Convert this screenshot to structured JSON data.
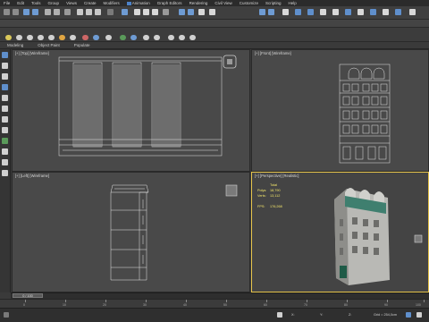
{
  "menu": {
    "items": [
      "File",
      "Edit",
      "Tools",
      "Group",
      "Views",
      "Create",
      "Modifiers",
      "Animation",
      "Graph Editors",
      "Rendering",
      "Civil View",
      "Customize",
      "Scripting",
      "Help"
    ]
  },
  "tabs": [
    "Modeling",
    "Object Paint",
    "Populate"
  ],
  "viewports": {
    "top_label": "[+] [Top] [Wireframe]",
    "front_label": "[+] [Front] [Wireframe]",
    "left_label": "[+] [Left] [Wireframe]",
    "persp_label": "[+] [Perspective] [Realistic]"
  },
  "stats": {
    "total_label": "Total",
    "polys_label": "Polys:",
    "polys_value": "18,790",
    "verts_label": "Verts:",
    "verts_value": "13,112",
    "fps_label": "FPS:",
    "fps_value": "176,268"
  },
  "timeline": {
    "slider": "0 / 100",
    "ticks": [
      "0",
      "10",
      "20",
      "30",
      "40",
      "50",
      "60",
      "70",
      "80",
      "90",
      "100"
    ]
  },
  "status": {
    "x_label": "X:",
    "y_label": "Y:",
    "z_label": "Z:",
    "grid": "Grid = 254,0cm"
  },
  "colors": {
    "active_border": "#e6c44c",
    "wire": "#e8e8e8",
    "stat_text": "#f3e66a"
  }
}
